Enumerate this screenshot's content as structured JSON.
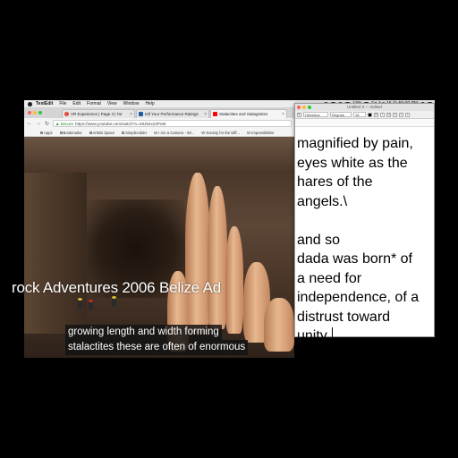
{
  "menubar": {
    "app_name": "TextEdit",
    "items": [
      "File",
      "Edit",
      "Format",
      "View",
      "Window",
      "Help"
    ],
    "clock": "Fri Jun 15  11:56:00 PM",
    "battery": "13%"
  },
  "browser": {
    "tabs": [
      {
        "label": "VR Experience | Page 3 | Tor",
        "favicon_color": "#e74c3c"
      },
      {
        "label": "Kill Your Performance Ratings",
        "favicon_color": "#1a5fa8"
      },
      {
        "label": "Stalactites and Stalagmites",
        "favicon_color": "#ff0000"
      }
    ],
    "address": {
      "secure_label": "Secure",
      "url": "https://www.youtube.com/watch?v=28J94x23PoM"
    },
    "bookmarks": [
      "Apps",
      "Bookmarks",
      "Artists Space",
      "SimpleAdder",
      "W I Am a Camera - Wi...",
      "W Society for the Diff...",
      "W Impossibilism"
    ]
  },
  "video": {
    "title_overlay": "rock Adventures 2006 Belize Ad",
    "captions": [
      "growing length and width forming",
      "stalactites these are often of enormous"
    ]
  },
  "textedit": {
    "window_title": "Untitled 3 — Edited",
    "toolbar": {
      "font": "Helvetica",
      "style": "Regular",
      "size": "18"
    },
    "text": "magnified by pain,\neyes white as the\nhares of the\nangels.\\\n\nand so\ndada was born* of\na need for\nindependence, of a\ndistrust toward\nunity."
  },
  "colors": {
    "close": "#ff5f57",
    "minimize": "#ffbd2e",
    "zoom": "#28c940"
  }
}
